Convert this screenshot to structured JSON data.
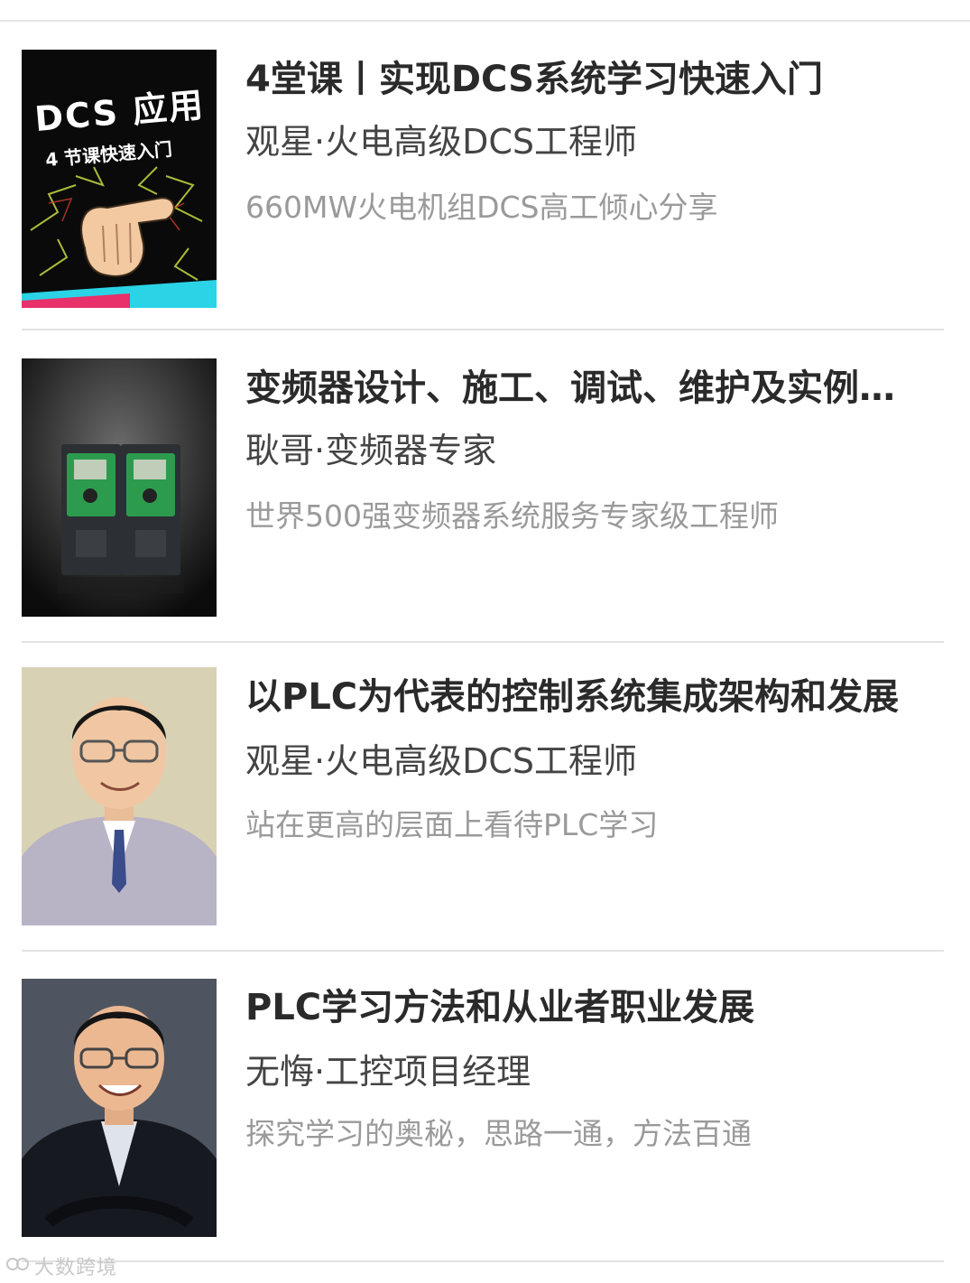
{
  "courses": [
    {
      "title": "4堂课丨实现DCS系统学习快速入门",
      "author": "观星·火电高级DCS工程师",
      "description": "660MW火电机组DCS高工倾心分享",
      "thumb": {
        "line1": "DCS 应用",
        "line2": "4 节课快速入门",
        "icon": "pointing-hand-icon"
      }
    },
    {
      "title": "变频器设计、施工、调试、维护及实例…",
      "author": "耿哥·变频器专家",
      "description": "世界500强变频器系统服务专家级工程师",
      "thumb": {
        "icon": "inverter-device-icon"
      }
    },
    {
      "title": "以PLC为代表的控制系统集成架构和发展",
      "author": "观星·火电高级DCS工程师",
      "description": "站在更高的层面上看待PLC学习",
      "thumb": {
        "icon": "instructor-photo-icon"
      }
    },
    {
      "title": "PLC学习方法和从业者职业发展",
      "author": "无悔·工控项目经理",
      "description": "探究学习的奥秘，思路一通，方法百通",
      "thumb": {
        "icon": "instructor-photo-icon"
      }
    }
  ],
  "watermark": "大数跨境",
  "colors": {
    "title": "#2a2a2a",
    "author": "#444444",
    "description": "#9a9a9a",
    "divider": "#e2e2e2"
  }
}
